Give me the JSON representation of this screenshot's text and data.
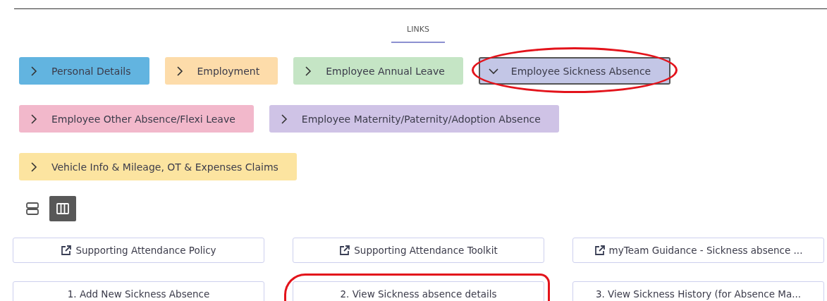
{
  "tab": {
    "label": "LINKS",
    "selected": true
  },
  "categories": [
    {
      "label": "Personal Details",
      "color": "#62b4e0",
      "expanded": false,
      "annotated": false
    },
    {
      "label": "Employment",
      "color": "#fddcaa",
      "expanded": false,
      "annotated": false
    },
    {
      "label": "Employee Annual Leave",
      "color": "#c5e5c5",
      "expanded": false,
      "annotated": false
    },
    {
      "label": "Employee Sickness Absence",
      "color": "#c3c6e6",
      "expanded": true,
      "annotated": true
    },
    {
      "label": "Employee Other Absence/Flexi Leave",
      "color": "#f2b8cb",
      "expanded": false,
      "annotated": false
    },
    {
      "label": "Employee Maternity/Paternity/Adoption Absence",
      "color": "#cfc3e6",
      "expanded": false,
      "annotated": false
    },
    {
      "label": "Vehicle Info & Mileage, OT & Expenses Claims",
      "color": "#fce4a0",
      "expanded": false,
      "annotated": false
    }
  ],
  "view_toggle": [
    {
      "kind": "rows",
      "selected": false
    },
    {
      "kind": "columns",
      "selected": true
    }
  ],
  "links": [
    {
      "label": "Supporting Attendance Policy",
      "kind": "external",
      "annotated": false
    },
    {
      "label": "Supporting Attendance Toolkit",
      "kind": "external",
      "annotated": false
    },
    {
      "label": "myTeam Guidance - Sickness absence ...",
      "kind": "external",
      "annotated": false
    },
    {
      "label": "1. Add New Sickness Absence",
      "kind": "internal",
      "annotated": false
    },
    {
      "label": "2. View Sickness absence details",
      "kind": "internal",
      "annotated": true
    },
    {
      "label": "3. View Sickness History (for Absence Ma...",
      "kind": "internal",
      "annotated": false
    }
  ]
}
